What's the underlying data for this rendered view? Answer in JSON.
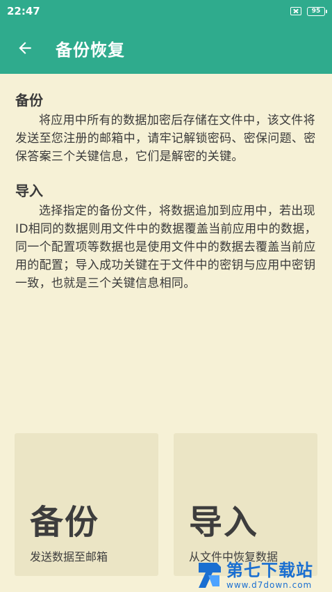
{
  "status_bar": {
    "time": "22:47",
    "battery": "95"
  },
  "app_bar": {
    "title": "备份恢复",
    "back_icon": "arrow-left-icon"
  },
  "sections": [
    {
      "title": "备份",
      "body": "将应用中所有的数据加密后存储在文件中，该文件将发送至您注册的邮箱中，请牢记解锁密码、密保问题、密保答案三个关键信息，它们是解密的关键。"
    },
    {
      "title": "导入",
      "body": "选择指定的备份文件，将数据追加到应用中，若出现ID相同的数据则用文件中的数据覆盖当前应用中的数据，同一个配置项等数据也是使用文件中的数据去覆盖当前应用的配置；导入成功关键在于文件中的密钥与应用中密钥一致，也就是三个关键信息相同。"
    }
  ],
  "cards": {
    "backup": {
      "title": "备份",
      "subtitle": "发送数据至邮箱"
    },
    "import": {
      "title": "导入",
      "subtitle": "从文件中恢复数据"
    }
  },
  "watermark": {
    "name": "第七下载站",
    "url": "www.d7down.com"
  },
  "colors": {
    "primary": "#2fab8d",
    "background": "#f6f1d6",
    "card": "#ebe5c5",
    "watermark": "#1a6fd1"
  }
}
